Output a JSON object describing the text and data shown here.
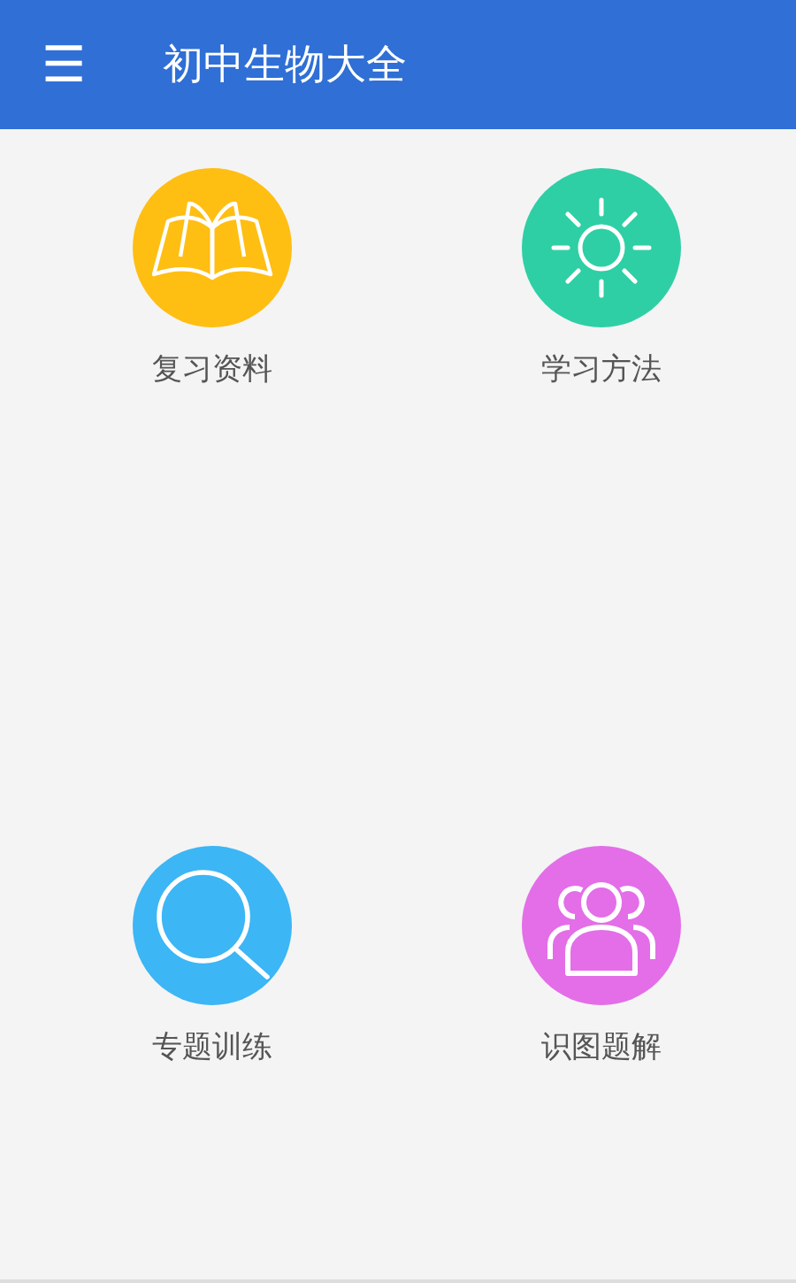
{
  "app_bar": {
    "menu_icon": "☰",
    "title": "初中生物大全"
  },
  "tiles": [
    {
      "label": "复习资料",
      "kind": "book",
      "color": "#ffbe12"
    },
    {
      "label": "学习方法",
      "kind": "sun",
      "color": "#2ecfa4"
    },
    {
      "label": "专题训练",
      "kind": "search",
      "color": "#3cb6f5"
    },
    {
      "label": "识图题解",
      "kind": "people",
      "color": "#e36ee8"
    }
  ]
}
